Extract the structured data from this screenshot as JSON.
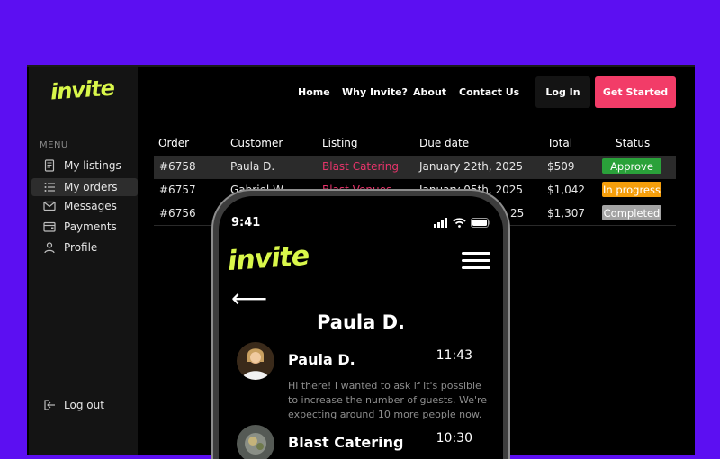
{
  "app": {
    "logo_text": "invite"
  },
  "nav": {
    "home": "Home",
    "why": "Why Invite?",
    "about": "About",
    "contact": "Contact Us",
    "login": "Log In",
    "get_started": "Get Started"
  },
  "sidebar": {
    "menu_label": "MENU",
    "items": [
      {
        "label": "My listings",
        "icon": "listing-icon"
      },
      {
        "label": "My orders",
        "icon": "orders-icon"
      },
      {
        "label": "Messages",
        "icon": "mail-icon"
      },
      {
        "label": "Payments",
        "icon": "wallet-icon"
      },
      {
        "label": "Profile",
        "icon": "user-icon"
      }
    ],
    "logout": "Log out"
  },
  "table": {
    "headers": [
      "Order",
      "Customer",
      "Listing",
      "Due date",
      "Total",
      "Status"
    ],
    "rows": [
      {
        "order": "#6758",
        "customer": "Paula D.",
        "listing": "Blast Catering",
        "due": "January 22th, 2025",
        "total": "$509",
        "status": "Approve",
        "status_color": "#2aa13a"
      },
      {
        "order": "#6757",
        "customer": "Gabriel W.",
        "listing": "Blast Venues",
        "due": "January 05th, 2025",
        "total": "$1,042",
        "status": "In progress",
        "status_color": "#f59e0b"
      },
      {
        "order": "#6756",
        "customer": "",
        "listing": "",
        "due": "25",
        "total": "$1,307",
        "status": "Completed",
        "status_color": "#a3a3a3"
      }
    ]
  },
  "phone": {
    "time": "9:41",
    "logo_text": "invite",
    "back_arrow": "⟵",
    "title": "Paula D.",
    "messages": [
      {
        "name": "Paula D.",
        "time": "11:43",
        "text": "Hi there! I wanted to ask if it's possible to increase the number of guests. We're expecting around 10 more people now."
      },
      {
        "name": "Blast Catering",
        "time": "10:30",
        "text": ""
      }
    ]
  },
  "colors": {
    "background": "#5c0ff2",
    "accent": "#d9f74a",
    "brand_pink": "#f23c68"
  }
}
